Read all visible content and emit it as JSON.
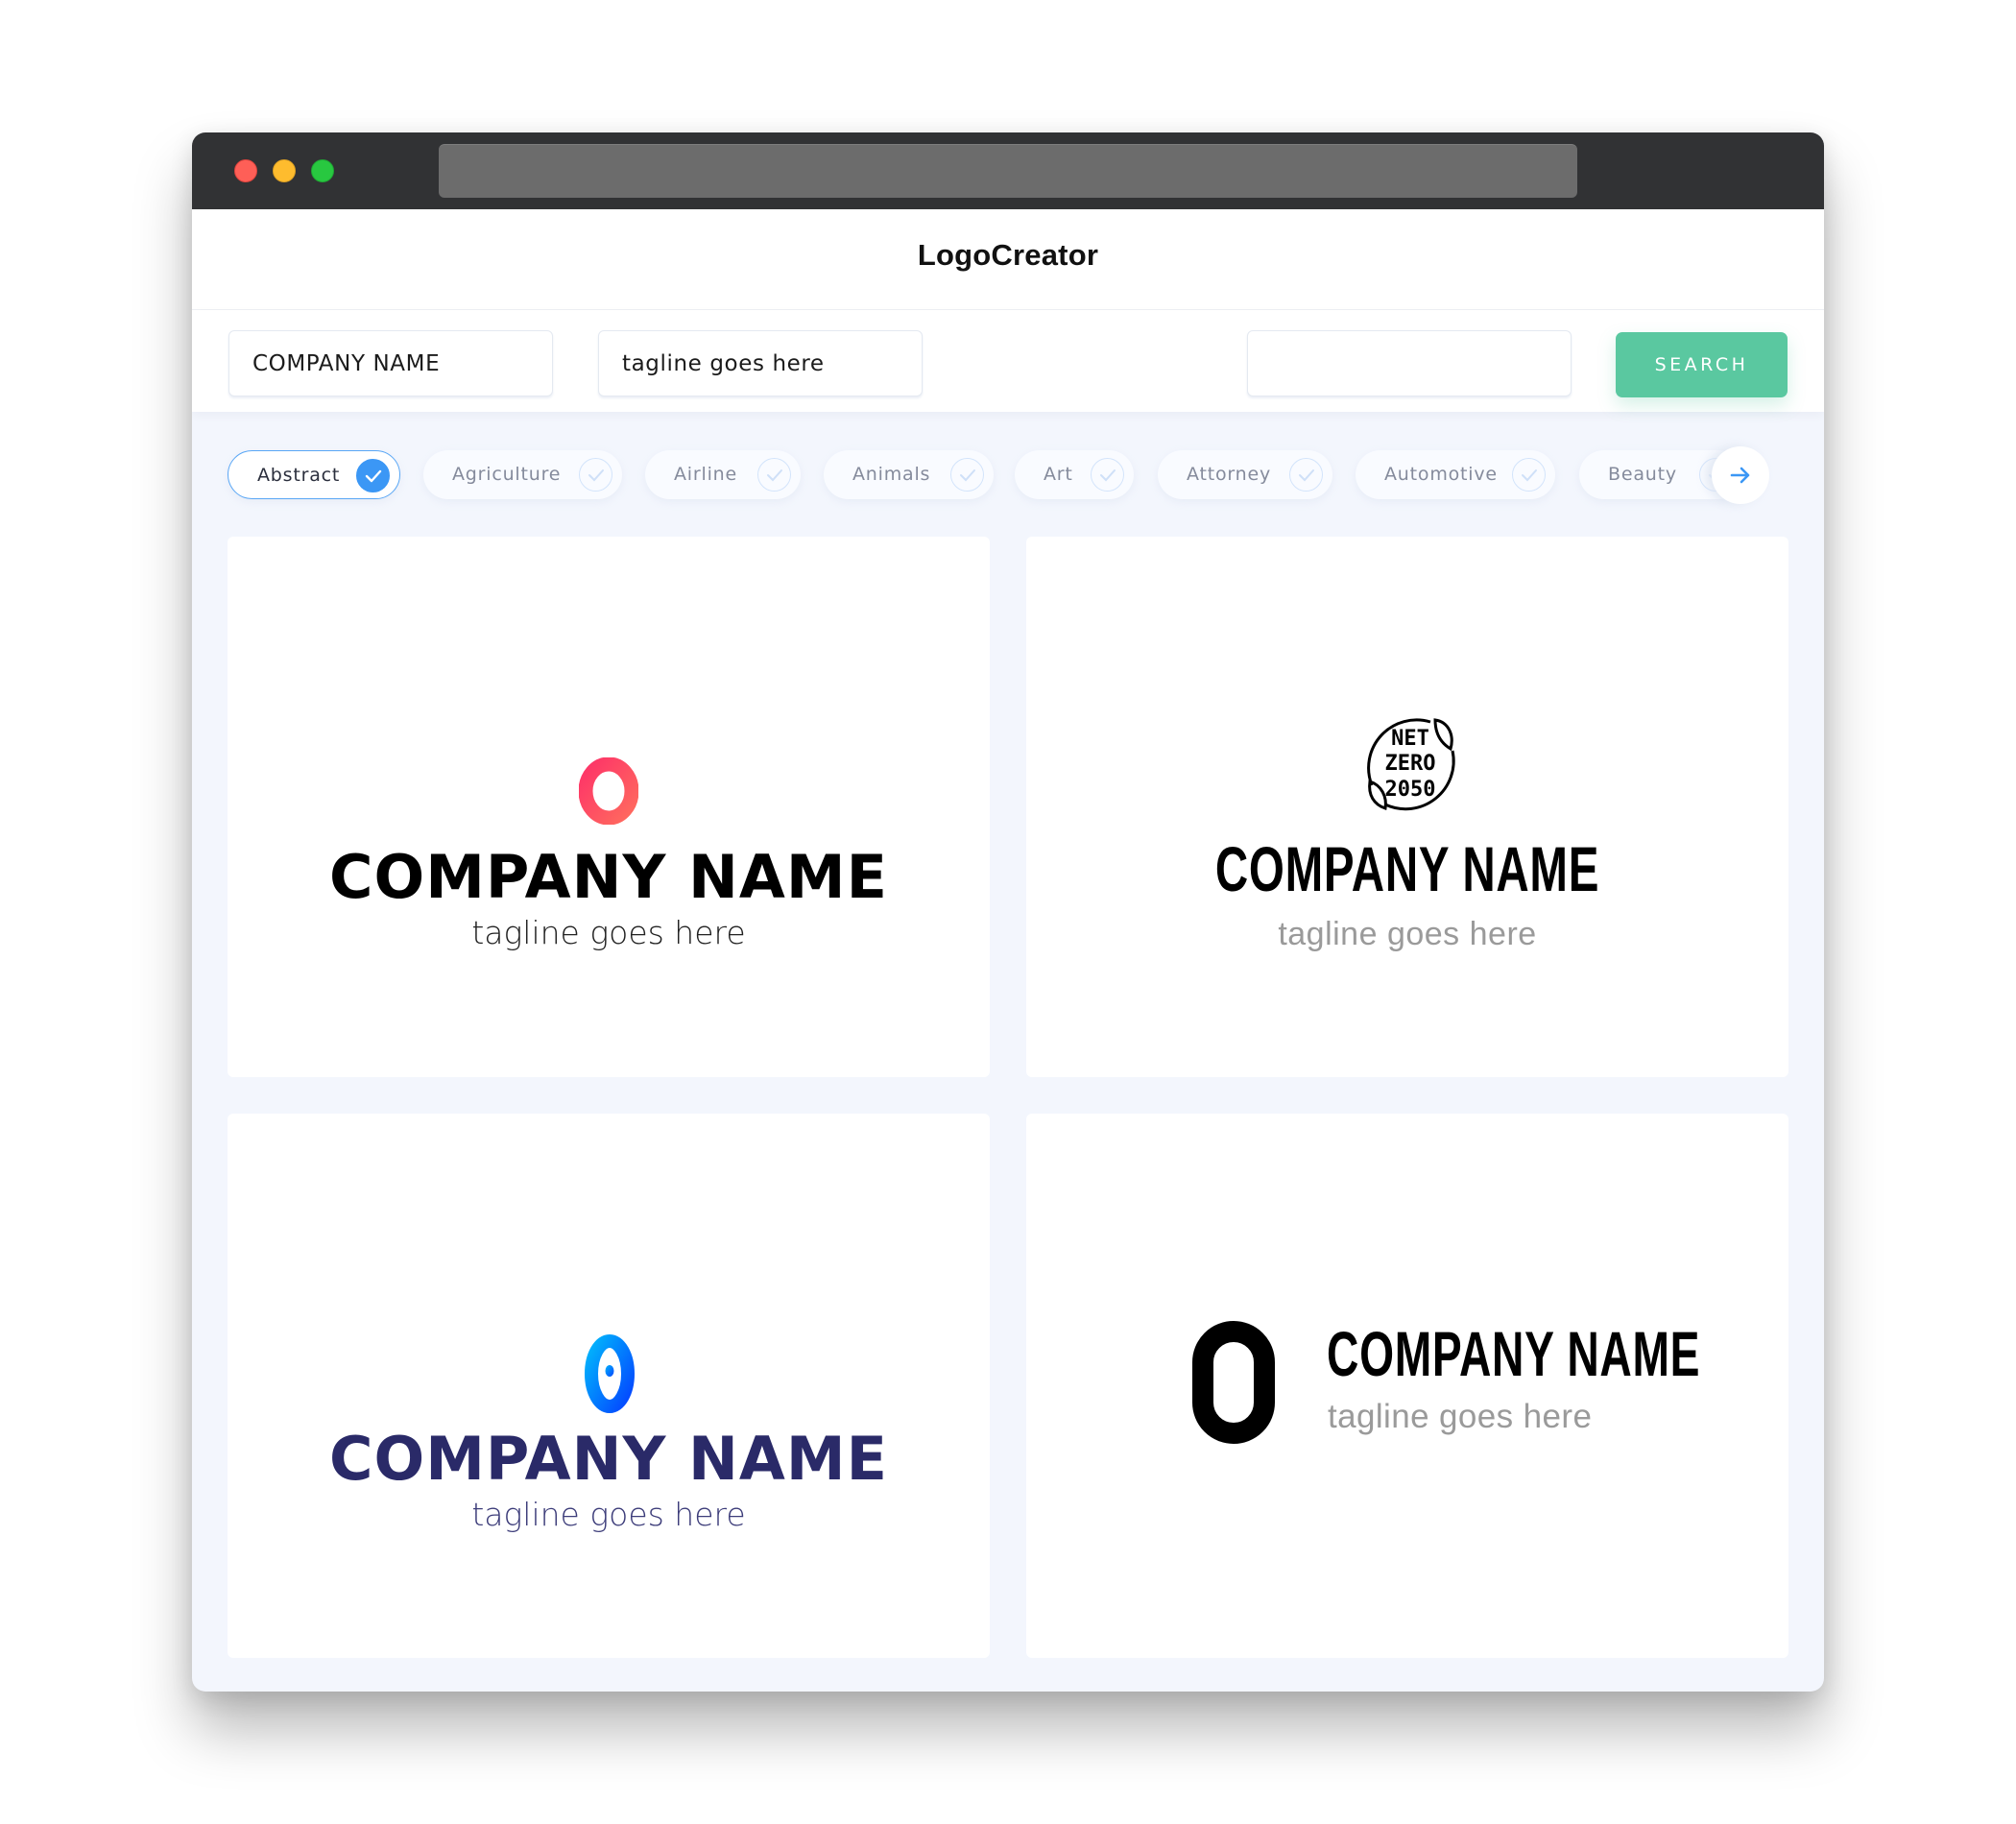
{
  "window": {
    "controls": [
      "close",
      "minimize",
      "maximize"
    ],
    "colors": {
      "close": "#fe5f57",
      "minimize": "#febc2e",
      "maximize": "#28c840"
    }
  },
  "header": {
    "brand": "LogoCreator"
  },
  "search": {
    "company_name_value": "COMPANY NAME",
    "tagline_value": "tagline goes here",
    "query_value": "",
    "button_label": "SEARCH",
    "button_color": "#5ac8a0"
  },
  "categories": {
    "items": [
      {
        "label": "Abstract",
        "selected": true
      },
      {
        "label": "Agriculture",
        "selected": false
      },
      {
        "label": "Airline",
        "selected": false
      },
      {
        "label": "Animals",
        "selected": false
      },
      {
        "label": "Art",
        "selected": false
      },
      {
        "label": "Attorney",
        "selected": false
      },
      {
        "label": "Automotive",
        "selected": false
      },
      {
        "label": "Beauty",
        "selected": false
      }
    ],
    "next_icon": "arrow-right-icon",
    "accent": "#3b97f5"
  },
  "logos": [
    {
      "icon": "letter-o-gradient-pink",
      "icon_text": "O",
      "name": "COMPANY NAME",
      "tagline": "tagline goes here",
      "name_color": "#000000",
      "tagline_color": "#222222",
      "gradient": [
        "#fd3468",
        "#ff6a5e"
      ]
    },
    {
      "icon": "net-zero-2050-badge",
      "badge_lines": [
        "NET",
        "ZERO",
        "2050"
      ],
      "name": "COMPANY NAME",
      "tagline": "tagline goes here",
      "name_color": "#000000",
      "tagline_color": "#9a9a9a"
    },
    {
      "icon": "letter-o-gradient-blue",
      "name": "COMPANY NAME",
      "tagline": "tagline goes here",
      "name_color": "#2a2a68",
      "tagline_color": "#3d3d7a",
      "gradient": [
        "#02b4fc",
        "#0346ff"
      ]
    },
    {
      "icon": "letter-o-black",
      "name": "COMPANY NAME",
      "tagline": "tagline goes here",
      "name_color": "#000000",
      "tagline_color": "#9a9a9a"
    }
  ]
}
